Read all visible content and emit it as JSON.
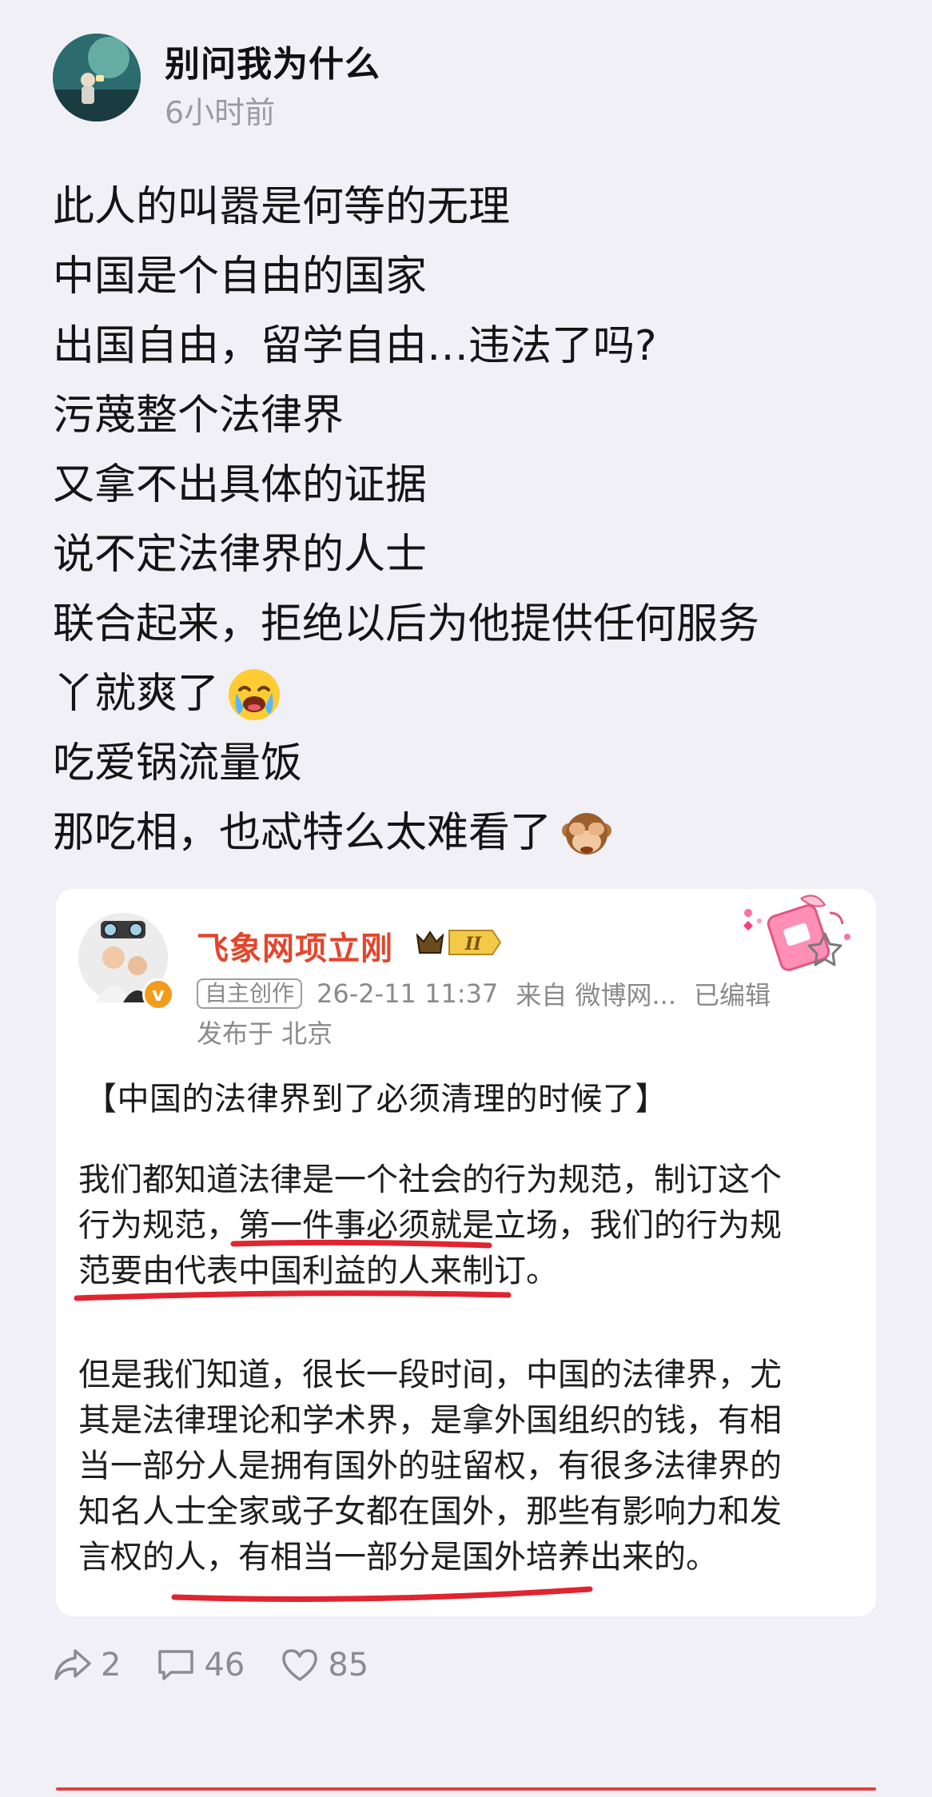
{
  "post": {
    "author": "别问我为什么",
    "time": "6小时前",
    "lines": [
      "此人的叫嚣是何等的无理",
      "中国是个自由的国家",
      "出国自由，留学自由…违法了吗?",
      "污蔑整个法律界",
      "又拿不出具体的证据",
      "说不定法律界的人士",
      "联合起来，拒绝以后为他提供任何服务",
      "丫就爽了",
      "吃爱锅流量饭",
      "那吃相，也忒特么太难看了"
    ],
    "emoji_line_8": "loudly-crying-face-icon",
    "emoji_line_10": "see-no-evil-monkey-icon"
  },
  "quoted": {
    "name": "飞象网项立刚",
    "vip_level": "II",
    "tag": "自主创作",
    "datetime": "26-2-11 11:37",
    "source": "来自 微博网...",
    "edited": "已编辑",
    "location": "发布于 北京",
    "title": "【中国的法律界到了必须清理的时候了】",
    "para1": [
      "我们都知道法律是一个社会的行为规范，制订这个",
      "行为规范，第一件事必须就是立场，我们的行为规",
      "范要由代表中国利益的人来制订。"
    ],
    "para2": [
      "但是我们知道，很长一段时间，中国的法律界，尤",
      "其是法律理论和学术界，是拿外国组织的钱，有相",
      "当一部分人是拥有国外的驻留权，有很多法律界的",
      "知名人士全家或子女都在国外，那些有影响力和发",
      "言权的人，有相当一部分是国外培养出来的。"
    ],
    "annotation_color": "#e02530"
  },
  "actions": {
    "share_count": "2",
    "comment_count": "46",
    "like_count": "85"
  },
  "colors": {
    "background": "#f1f0f7",
    "name_accent": "#e2462d",
    "muted": "#8a8a8a"
  }
}
